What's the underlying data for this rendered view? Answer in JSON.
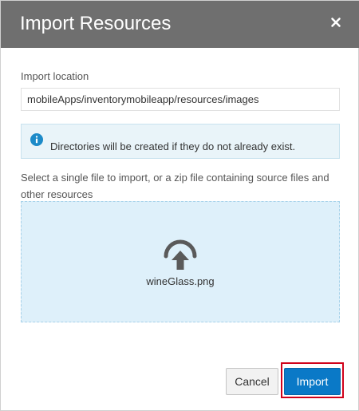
{
  "dialog": {
    "title": "Import Resources",
    "close_icon": "close-icon"
  },
  "location": {
    "label": "Import location",
    "value": "mobileApps/inventorymobileapp/resources/images"
  },
  "info": {
    "icon": "info-icon",
    "text": "Directories will be created if they do not already exist."
  },
  "instructions": "Select a single file to import, or a zip file containing source files and other resources",
  "dropzone": {
    "icon": "upload-arrow-icon",
    "file_name": "wineGlass.png"
  },
  "buttons": {
    "cancel_label": "Cancel",
    "import_label": "Import"
  },
  "colors": {
    "header_bg": "#6f6f6f",
    "info_icon": "#1c8ac8",
    "dropzone_bg": "#def0fa",
    "primary_button": "#0a79c7",
    "highlight_box": "#d0021b"
  }
}
